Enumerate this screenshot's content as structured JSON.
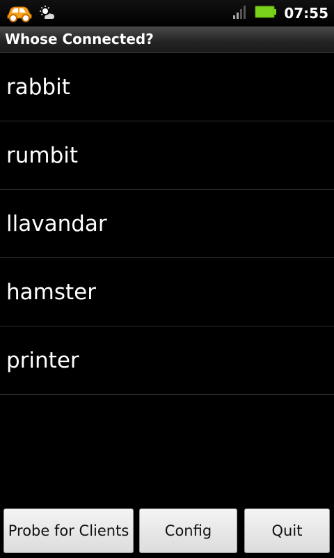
{
  "status_bar": {
    "time": "07:55",
    "icons": {
      "notification_1": "car-icon",
      "notification_2": "weather-icon",
      "signal": "signal-icon",
      "battery": "battery-icon"
    },
    "battery_color": "#7ad31a"
  },
  "title_bar": {
    "title": "Whose Connected?"
  },
  "clients": [
    {
      "name": "rabbit"
    },
    {
      "name": "rumbit"
    },
    {
      "name": "llavandar"
    },
    {
      "name": "hamster"
    },
    {
      "name": "printer"
    }
  ],
  "buttons": {
    "probe_label": "Probe for Clients",
    "config_label": "Config",
    "quit_label": "Quit"
  }
}
